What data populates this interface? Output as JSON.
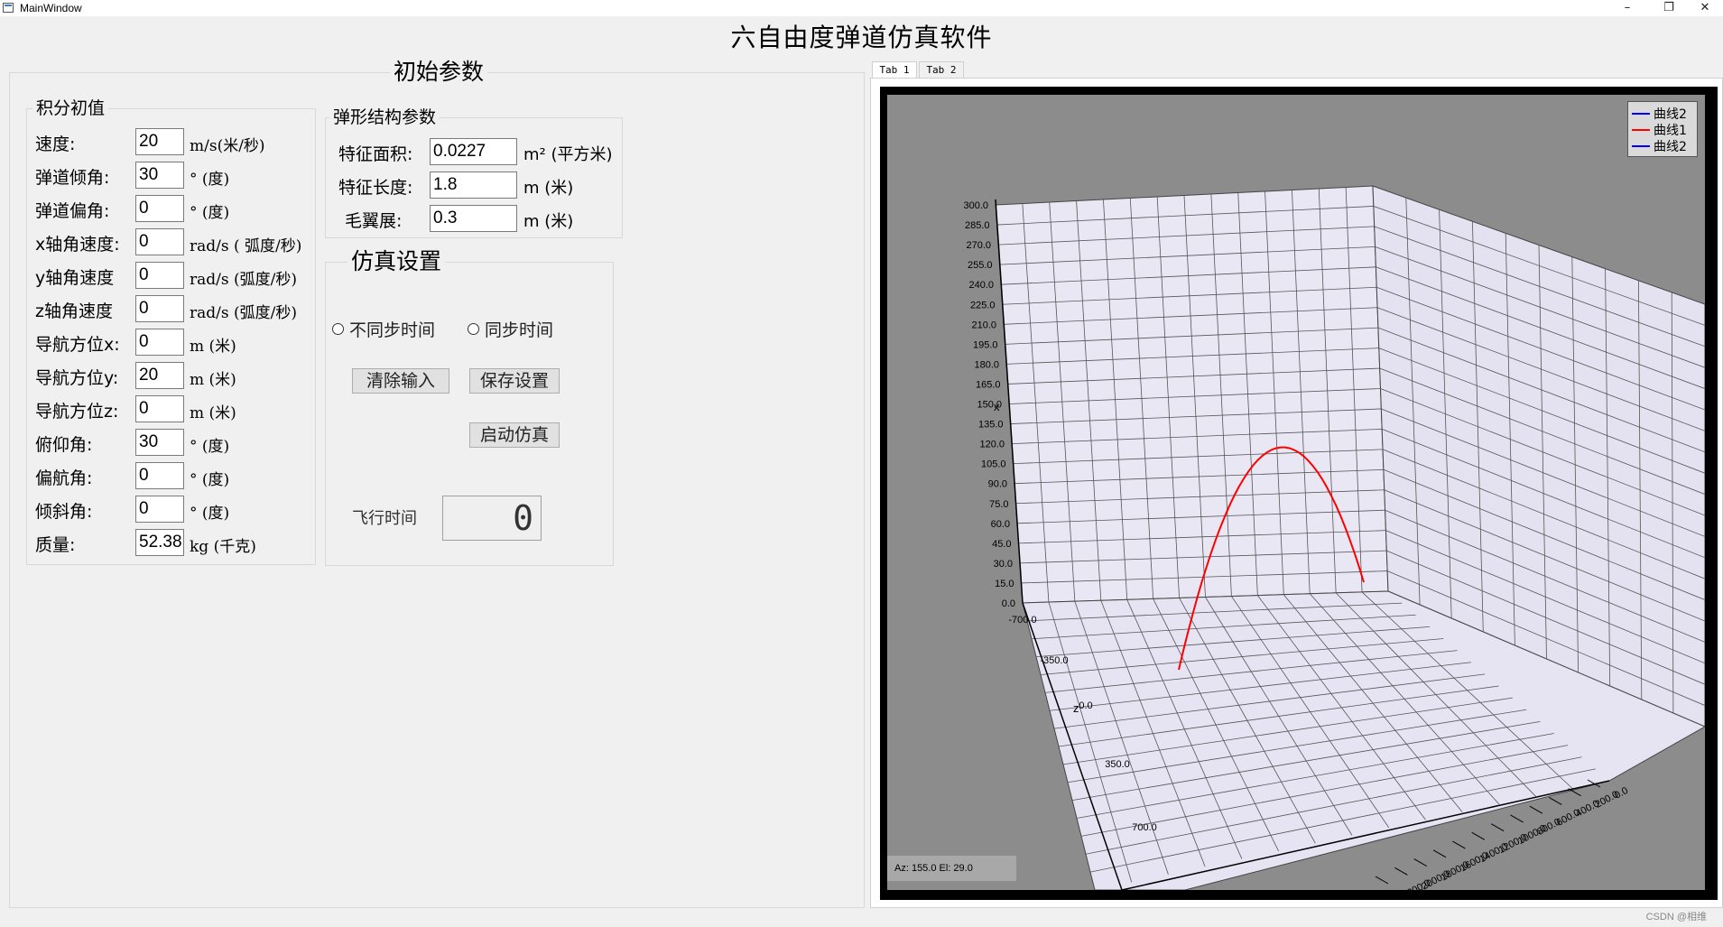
{
  "window": {
    "title": "MainWindow",
    "minimize": "–",
    "restore": "❐",
    "close": "✕"
  },
  "app_title": "六自由度弹道仿真软件",
  "initial_params": {
    "title": "初始参数",
    "integration": {
      "title": "积分初值",
      "rows": [
        {
          "label": "速度:",
          "value": "20",
          "unit": "m/s(米/秒)"
        },
        {
          "label": "弹道倾角:",
          "value": "30",
          "unit": "°  (度)"
        },
        {
          "label": "弹道偏角:",
          "value": "0",
          "unit": "°  (度)"
        },
        {
          "label": "x轴角速度:",
          "value": "0",
          "unit": "rad/s  ( 弧度/秒)"
        },
        {
          "label": "y轴角速度",
          "value": "0",
          "unit": "rad/s  (弧度/秒)"
        },
        {
          "label": "z轴角速度",
          "value": "0",
          "unit": "rad/s  (弧度/秒)"
        },
        {
          "label": "导航方位x:",
          "value": "0",
          "unit": "m   (米)"
        },
        {
          "label": "导航方位y:",
          "value": "20",
          "unit": "m   (米)"
        },
        {
          "label": "导航方位z:",
          "value": "0",
          "unit": "m   (米)"
        },
        {
          "label": "俯仰角:",
          "value": "30",
          "unit": "°  (度)"
        },
        {
          "label": "偏航角:",
          "value": "0",
          "unit": "°  (度)"
        },
        {
          "label": "倾斜角:",
          "value": "0",
          "unit": "°  (度)"
        },
        {
          "label": "质量:",
          "value": "52.38",
          "unit": "kg  (千克)"
        }
      ]
    },
    "structure": {
      "title": "弹形结构参数",
      "rows": [
        {
          "label": "特征面积:",
          "value": "0.0227",
          "unit": "m²  (平方米)"
        },
        {
          "label": "特征长度:",
          "value": "1.8",
          "unit": "m   (米)"
        },
        {
          "label": "毛翼展:",
          "value": "0.3",
          "unit": "m   (米)"
        }
      ]
    }
  },
  "sim_settings": {
    "title": "仿真设置",
    "radio_async": "不同步时间",
    "radio_sync": "同步时间",
    "clear_button": "清除输入",
    "save_button": "保存设置",
    "start_button": "启动仿真",
    "flight_time_label": "飞行时间",
    "flight_time_value": "0"
  },
  "tabs": [
    {
      "label": "Tab 1",
      "active": true
    },
    {
      "label": "Tab 2",
      "active": false
    }
  ],
  "plot": {
    "legend": [
      {
        "name": "曲线2",
        "color": "#0000ff"
      },
      {
        "name": "曲线1",
        "color": "#ff0000"
      },
      {
        "name": "曲线2",
        "color": "#0000ff"
      }
    ],
    "azel": "Az: 155.0 El: 29.0",
    "vertical_axis_label": "x",
    "depth_axis_label": "z",
    "vertical_ticks": [
      "300.0",
      "285.0",
      "270.0",
      "255.0",
      "240.0",
      "225.0",
      "210.0",
      "195.0",
      "180.0",
      "165.0",
      "150.0",
      "135.0",
      "120.0",
      "105.0",
      "90.0",
      "75.0",
      "60.0",
      "45.0",
      "30.0",
      "15.0",
      "0.0"
    ],
    "left_ticks": [
      "-700.0",
      "-350.0",
      "0.0",
      "350.0",
      "700.0"
    ],
    "bottom_ticks": [
      "0.0",
      "200.0",
      "400.0",
      "600.0",
      "800.0",
      "1000.0",
      "1200.0",
      "1400.0",
      "1600.0",
      "1800.0",
      "2000.0",
      "2200.0"
    ]
  },
  "watermark": "CSDN @相维"
}
